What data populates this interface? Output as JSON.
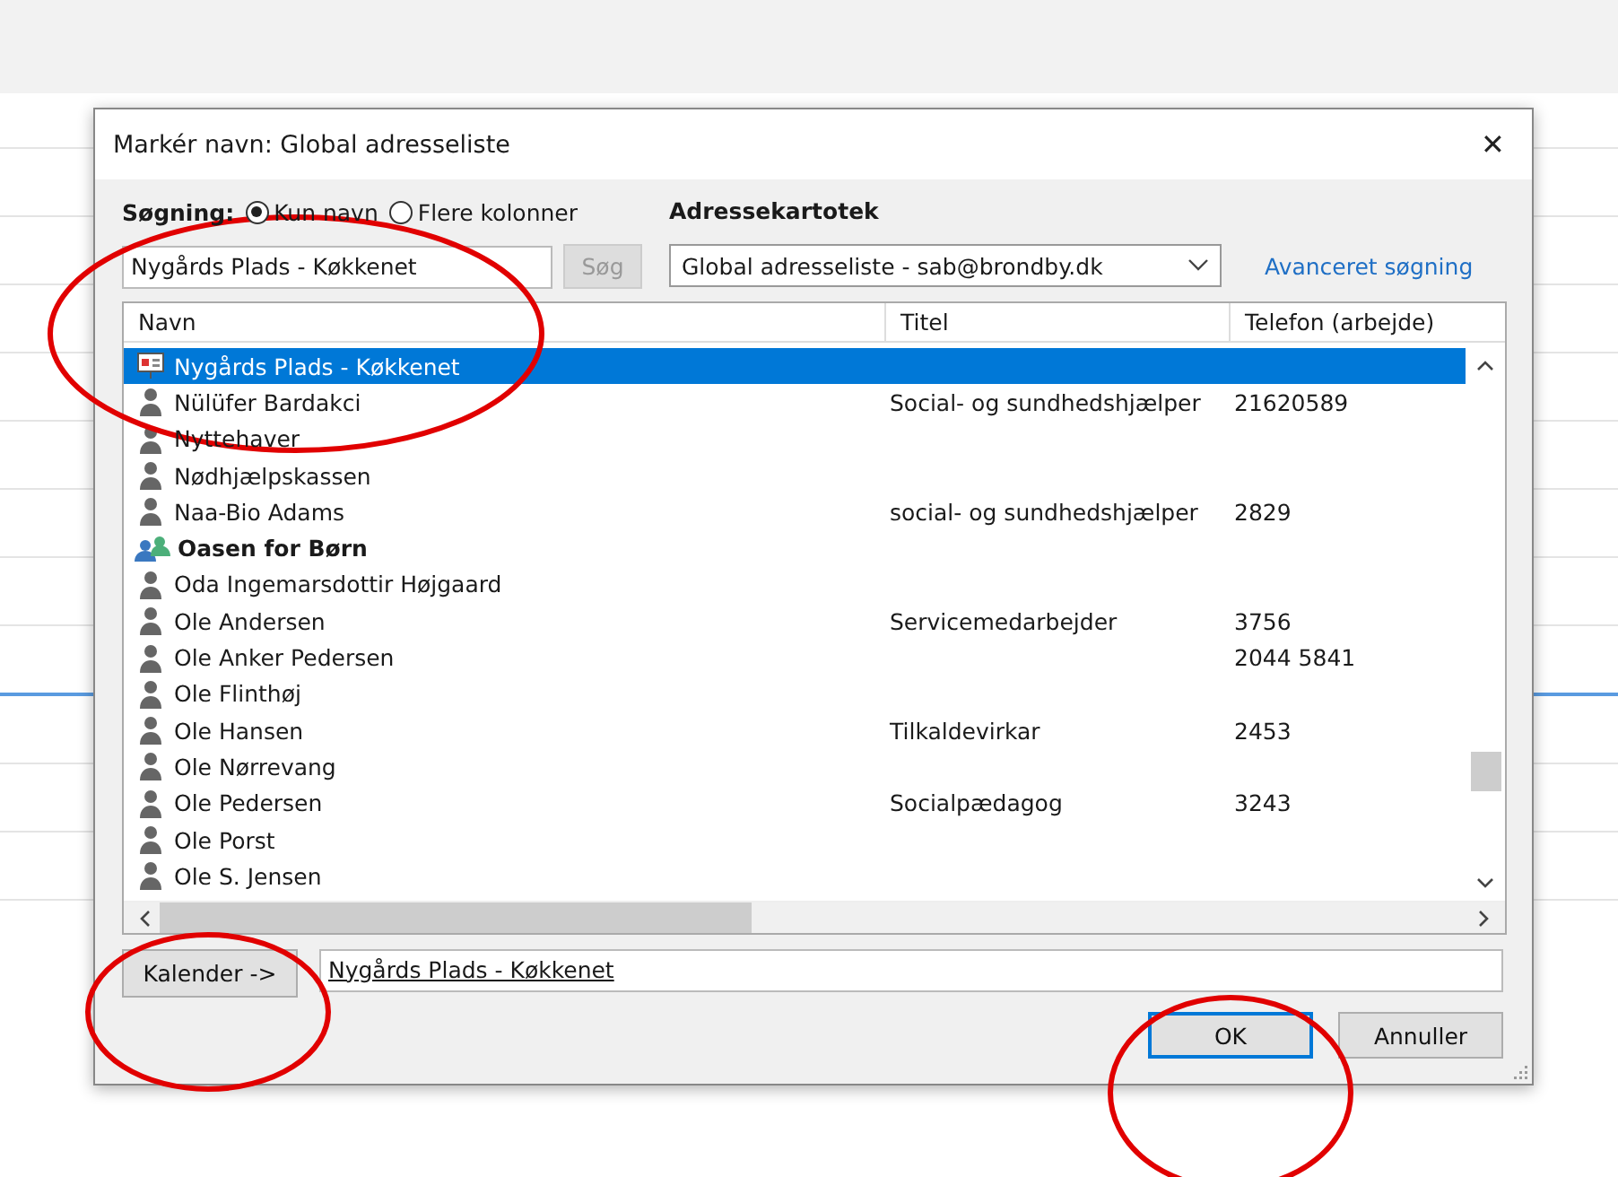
{
  "dialog": {
    "title": "Markér navn: Global adresseliste",
    "close": "✕"
  },
  "search": {
    "label": "Søgning:",
    "modes": [
      {
        "label": "Kun navn",
        "selected": true
      },
      {
        "label": "Flere kolonner",
        "selected": false
      }
    ],
    "value": "Nygårds Plads - Køkkenet",
    "button": {
      "label": "Søg",
      "disabled": true
    }
  },
  "address_book": {
    "label": "Adressekartotek",
    "value": "Global adresseliste - sab@brondby.dk",
    "advanced_link": "Avanceret søgning"
  },
  "table": {
    "columns": [
      "Navn",
      "Titel",
      "Telefon (arbejde)"
    ],
    "rows": [
      {
        "kind": "room",
        "name": "Nygårds Plads - Køkkenet",
        "title": "",
        "phone": "",
        "selected": true
      },
      {
        "kind": "person",
        "name": "Nülüfer Bardakci",
        "title": "Social- og sundhedshjælper",
        "phone": "21620589",
        "selected": false
      },
      {
        "kind": "person",
        "name": "Nyttehaver",
        "title": "",
        "phone": "",
        "selected": false
      },
      {
        "kind": "person",
        "name": "Nødhjælpskassen",
        "title": "",
        "phone": "",
        "selected": false
      },
      {
        "kind": "person",
        "name": "Naa-Bio Adams",
        "title": "social- og sundhedshjælper",
        "phone": "2829",
        "selected": false
      },
      {
        "kind": "group",
        "name": "Oasen for Børn",
        "title": "",
        "phone": "",
        "selected": false
      },
      {
        "kind": "person",
        "name": "Oda Ingemarsdottir Højgaard",
        "title": "",
        "phone": "",
        "selected": false
      },
      {
        "kind": "person",
        "name": "Ole Andersen",
        "title": "Servicemedarbejder",
        "phone": "3756",
        "selected": false
      },
      {
        "kind": "person",
        "name": "Ole Anker Pedersen",
        "title": "",
        "phone": "2044 5841",
        "selected": false
      },
      {
        "kind": "person",
        "name": "Ole Flinthøj",
        "title": "",
        "phone": "",
        "selected": false
      },
      {
        "kind": "person",
        "name": "Ole Hansen",
        "title": "Tilkaldevirkar",
        "phone": "2453",
        "selected": false
      },
      {
        "kind": "person",
        "name": "Ole Nørrevang",
        "title": "",
        "phone": "",
        "selected": false
      },
      {
        "kind": "person",
        "name": "Ole Pedersen",
        "title": "Socialpædagog",
        "phone": "3243",
        "selected": false
      },
      {
        "kind": "person",
        "name": "Ole Porst",
        "title": "",
        "phone": "",
        "selected": false
      },
      {
        "kind": "person",
        "name": "Ole S. Jensen",
        "title": "",
        "phone": "",
        "selected": false
      }
    ]
  },
  "calendar": {
    "button": "Kalender ->",
    "value": "Nygårds Plads - Køkkenet"
  },
  "buttons": [
    {
      "label": "OK",
      "default": true
    },
    {
      "label": "Annuller",
      "default": false
    }
  ]
}
